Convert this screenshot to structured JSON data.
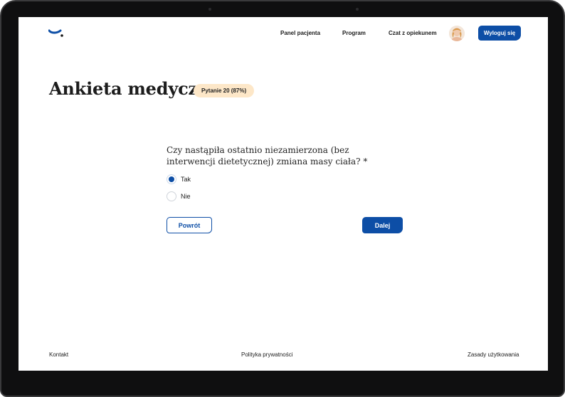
{
  "nav": {
    "patient_panel": "Panel pacjenta",
    "program": "Program",
    "chat": "Czat z opiekunem",
    "logout": "Wyloguj się"
  },
  "survey": {
    "title": "Ankieta medyczna",
    "progress": "Pytanie 20 (87%)",
    "question": "Czy nastąpiła ostatnio niezamierzona (bez interwencji dietetycznej) zmiana masy ciała? *",
    "options": [
      {
        "label": "Tak",
        "selected": true
      },
      {
        "label": "Nie",
        "selected": false
      }
    ],
    "back_label": "Powrót",
    "next_label": "Dalej"
  },
  "footer": {
    "contact": "Kontakt",
    "privacy": "Polityka prywatności",
    "terms": "Zasady użytkowania"
  },
  "colors": {
    "accent": "#0d4ea6",
    "badge_bg": "#fde7c8",
    "frame": "#0f0f10"
  }
}
